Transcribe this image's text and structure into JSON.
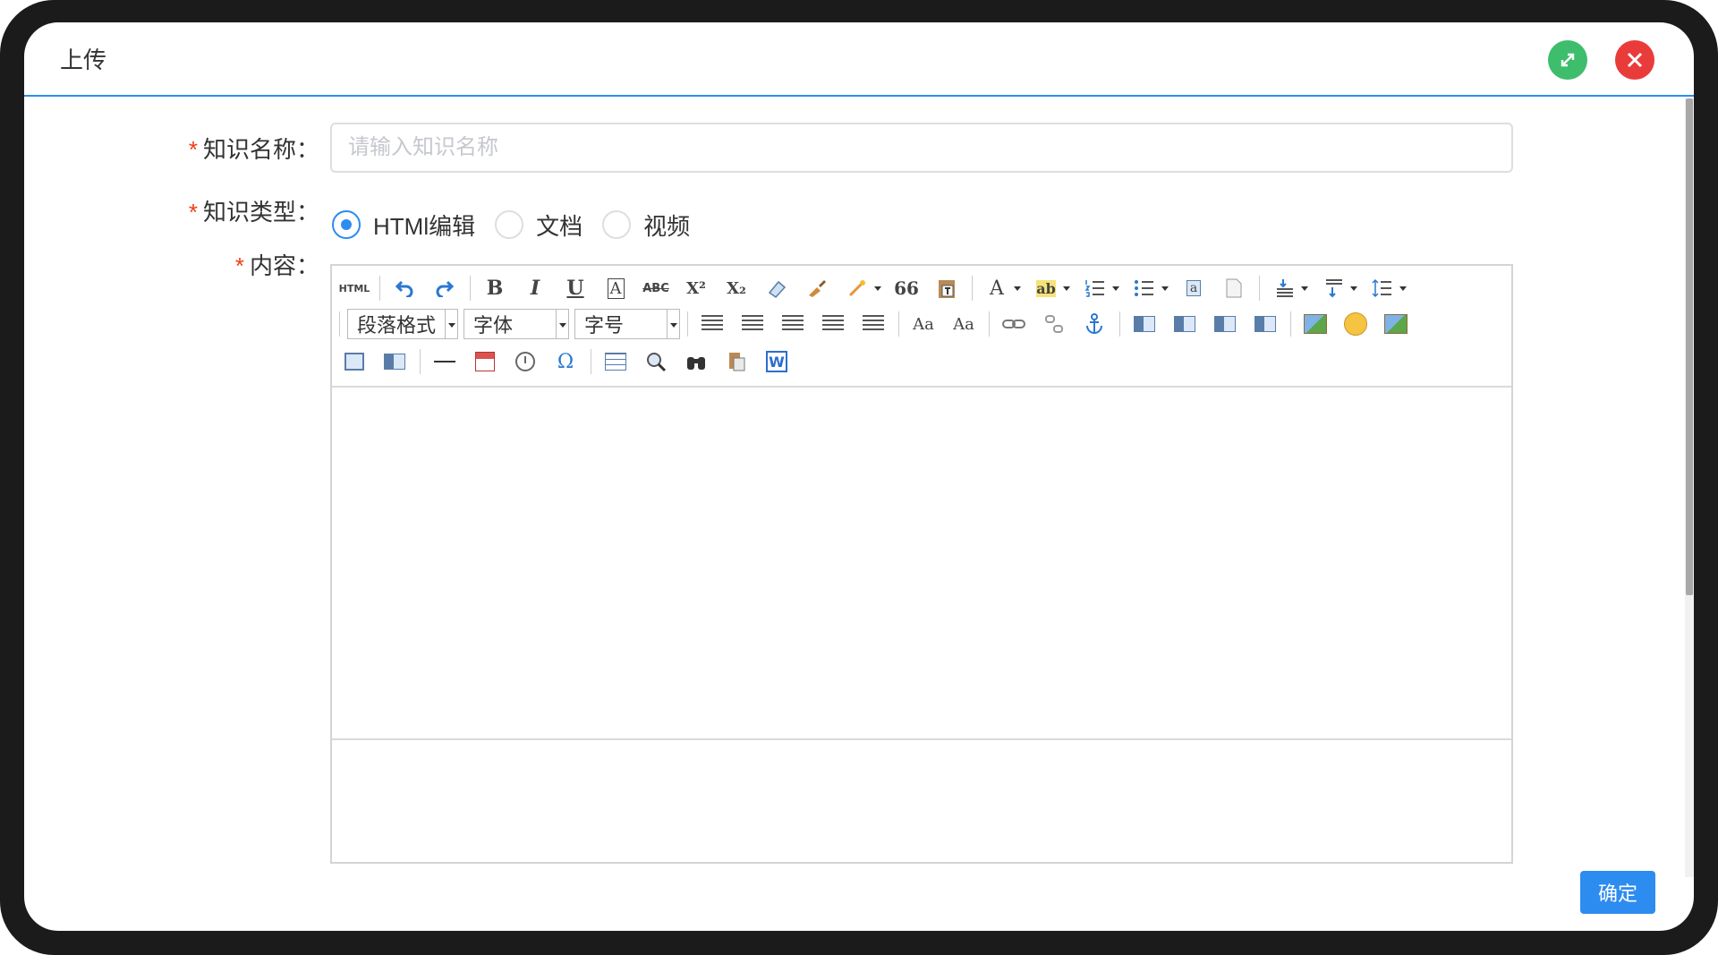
{
  "dialog": {
    "title": "上传",
    "maximize_icon": "expand-arrows-icon",
    "close_icon": "close-x-icon",
    "colors": {
      "accent": "#2d8cf0",
      "maximize": "#3ebd6d",
      "close": "#ea3b3b",
      "required": "#ed3f14"
    }
  },
  "form": {
    "name": {
      "label": "知识名称：",
      "required_mark": "*",
      "placeholder": "请输入知识名称",
      "value": ""
    },
    "type": {
      "label": "知识类型：",
      "required_mark": "*",
      "options": [
        "HTMl编辑",
        "文档",
        "视频"
      ],
      "selected": "HTMl编辑"
    },
    "content": {
      "label": "内容：",
      "required_mark": "*"
    }
  },
  "toolbar": {
    "html_label": "HTML",
    "bold": "B",
    "italic": "I",
    "underline": "U",
    "font_border": "A",
    "strikethrough": "ABC",
    "superscript": "X²",
    "subscript": "X₂",
    "blockquote": "66",
    "font_color": "A",
    "highlight": "ab",
    "paragraph_format": "段落格式",
    "font_family": "字体",
    "font_size": "字号",
    "special_char": "Ω",
    "word_icon_letter": "W"
  },
  "actions": {
    "confirm": "确定"
  }
}
